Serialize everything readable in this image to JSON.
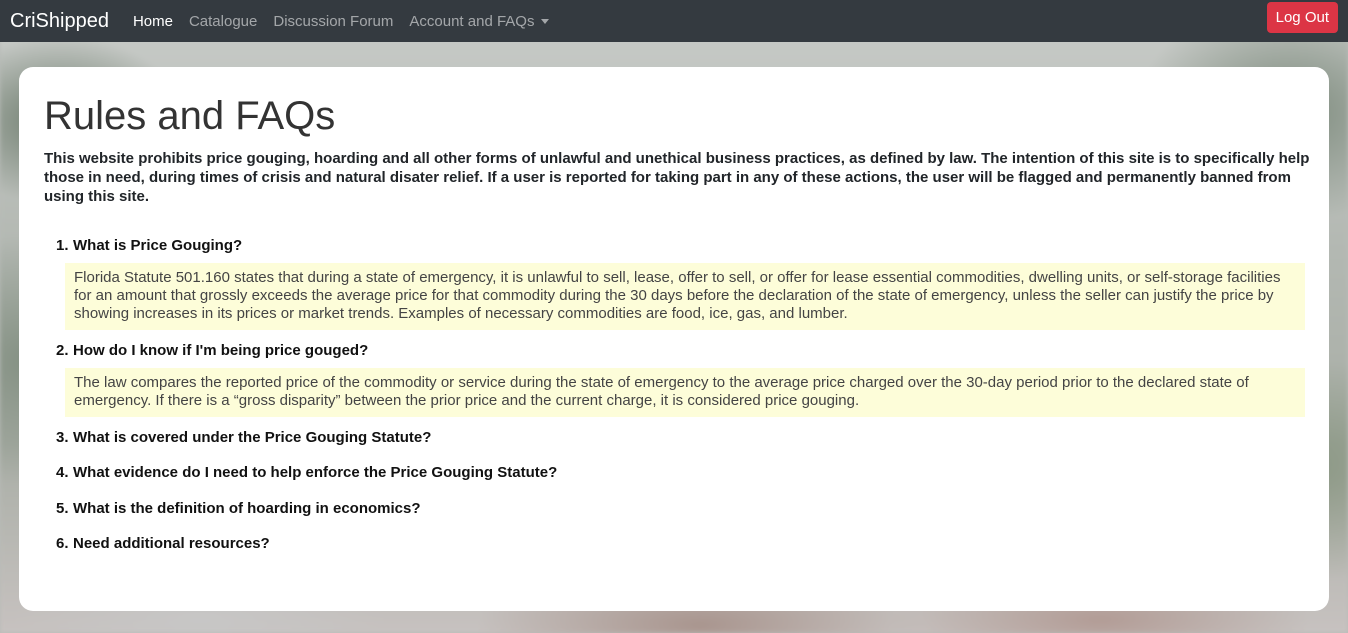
{
  "nav": {
    "brand": "CriShipped",
    "links": [
      "Home",
      "Catalogue",
      "Discussion Forum",
      "Account and FAQs"
    ],
    "logout_label": "Log Out"
  },
  "page": {
    "title": "Rules and FAQs",
    "intro": "This website prohibits price gouging, hoarding and all other forms of unlawful and unethical business practices, as defined by law. The intention of this site is to specifically help those in need, during times of crisis and natural disater relief. If a user is reported for taking part in any of these actions, the user will be flagged and permanently banned from using this site."
  },
  "faqs": [
    {
      "num": "1.",
      "question": "What is Price Gouging?",
      "answer": "Florida Statute 501.160 states that during a state of emergency, it is unlawful to sell, lease, offer to sell, or offer for lease essential commodities, dwelling units, or self-storage facilities for an amount that grossly exceeds the average price for that commodity during the 30 days before the declaration of the state of emergency, unless the seller can justify the price by showing increases in its prices or market trends. Examples of necessary commodities are food, ice, gas, and lumber."
    },
    {
      "num": "2.",
      "question": "How do I know if I'm being price gouged?",
      "answer": "The law compares the reported price of the commodity or service during the state of emergency to the average price charged over the 30-day period prior to the declared state of emergency. If there is a “gross disparity” between the prior price and the current charge, it is considered price gouging."
    },
    {
      "num": "3.",
      "question": "What is covered under the Price Gouging Statute?"
    },
    {
      "num": "4.",
      "question": "What evidence do I need to help enforce the Price Gouging Statute?"
    },
    {
      "num": "5.",
      "question": "What is the definition of hoarding in economics?"
    },
    {
      "num": "6.",
      "question": "Need additional resources?"
    }
  ]
}
